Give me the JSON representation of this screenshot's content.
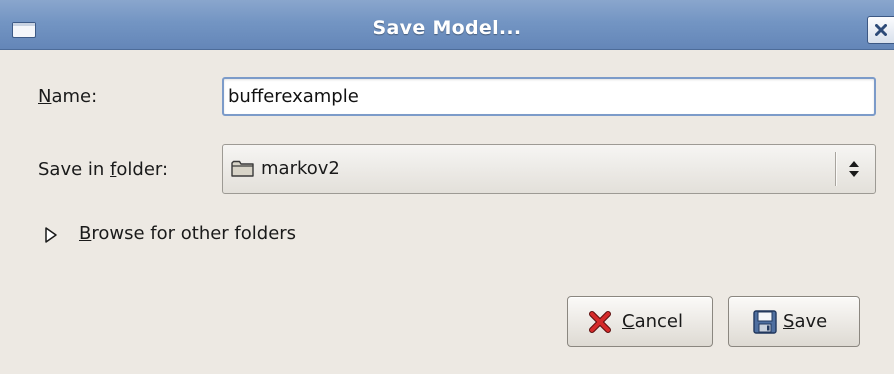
{
  "window": {
    "title": "Save Model...",
    "menu_icon": "window-menu-icon",
    "close_icon": "close-icon"
  },
  "name_field": {
    "label_mnemonic": "N",
    "label_rest": "ame:",
    "value": "bufferexample"
  },
  "folder_field": {
    "label_before": "Save in ",
    "label_mnemonic": "f",
    "label_after": "older:",
    "selected": "markov2",
    "icon": "folder-icon",
    "arrows_icon": "up-down-arrows-icon"
  },
  "expander": {
    "label_mnemonic": "B",
    "label_rest": "rowse for other folders",
    "icon": "triangle-right-icon"
  },
  "buttons": {
    "cancel": {
      "mnemonic": "C",
      "rest": "ancel",
      "icon": "red-x-icon"
    },
    "save": {
      "mnemonic": "S",
      "rest": "ave",
      "icon": "floppy-disk-icon"
    }
  },
  "colors": {
    "titlebar": "#7395c3",
    "dialog_bg": "#ede9e3",
    "focus_border": "#7c9bc9",
    "cancel_icon": "#c41e1e"
  }
}
